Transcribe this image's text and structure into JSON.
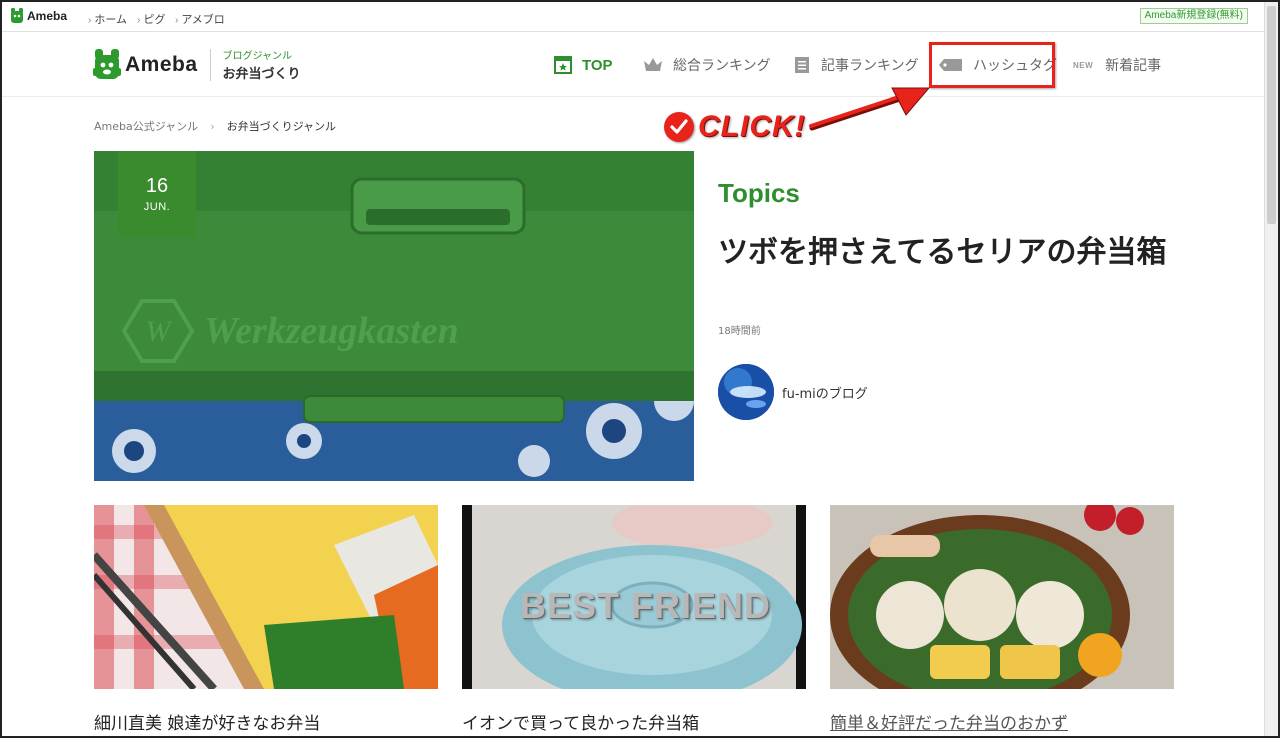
{
  "topbar": {
    "logo": "Ameba",
    "links": [
      "ホーム",
      "ピグ",
      "アメブロ"
    ],
    "signup": "Ameba新規登録(無料)"
  },
  "header": {
    "brand": "Ameba",
    "genre_label": "ブログジャンル",
    "genre_name": "お弁当づくり",
    "nav": {
      "top": "TOP",
      "ranking": "総合ランキング",
      "article_ranking": "記事ランキング",
      "hashtag": "ハッシュタグ",
      "new_tag": "NEW",
      "new_articles": "新着記事"
    },
    "accent_color": "#2d8f2d"
  },
  "annotation": {
    "click_text": "CLICK!",
    "color": "#e8231b"
  },
  "breadcrumb": {
    "parent": "Ameba公式ジャンル",
    "current": "お弁当づくりジャンル"
  },
  "hero": {
    "day": "16",
    "month": "JUN.",
    "label": "Topics",
    "title": "ツボを押さえてるセリアの弁当箱",
    "time": "18時間前",
    "author": "fu-miのブログ",
    "image_text": "Werkzeugkasten"
  },
  "cards": [
    {
      "title": "細川直美 娘達が好きなお弁当"
    },
    {
      "title": "イオンで買って良かった弁当箱",
      "overlay": "BEST FRIEND"
    },
    {
      "title": "簡単＆好評だった弁当のおかず"
    }
  ]
}
